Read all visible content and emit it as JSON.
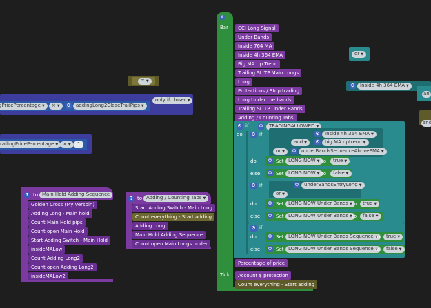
{
  "bar_block": {
    "bar_label": "Bar",
    "tick_label": "Tick",
    "items": [
      "CCI Long Signal",
      "Under Bands",
      "Inside 764 MA",
      "Inside 4h 364 EMA",
      "Big MA Up Trend",
      "Trailing SL TP Main Longs",
      "Long",
      "Protections / Stop trading",
      "Long Under the bands",
      "Trailing SL TP Under Bands",
      "Adding / Counting Tabs"
    ],
    "if_label": "if",
    "do_label": "do",
    "else_label": "else",
    "trading_allowed": "TRADINGALLOWED",
    "inside_4h": "Inside 4h 364 EMA",
    "and_op": "and",
    "big_ma": "big MA uptrend",
    "or_op": "or",
    "under_bands_seq": "underBandsSequenceAboveEMA",
    "set_label": "Set",
    "to_label": "to",
    "long_now": "LONG NOW",
    "true_val": "true",
    "false_val": "false",
    "under_bands_entry": "underBandsEntryLong",
    "long_now_under": "LONG NOW Under Bands",
    "long_now_under_seq": "LONG NOW Under Bands Sequence",
    "percentage_of_price": "Percentage of price",
    "account_protection": "Account $ protection",
    "count_everything": "Count everything - Start adding"
  },
  "left_blocks": {
    "price_percentage": "gPricePercentage",
    "times_op": "×",
    "adding_long": "addingLong2CloseTrailPips",
    "only_if_closer": "only if closer",
    "trailing_price": "railingPricePercentage",
    "times_op2": "×",
    "one_val": "1",
    "equals_op": "="
  },
  "func_main_hold": {
    "to_label": "to",
    "name": "Main Hold Adding Sequence",
    "items": [
      "Golden Cross (My Versoin)",
      "Adding Long - Main hold",
      "Count Main Hold pips",
      "Count open Main Hold",
      "Start Adding Switch - Main Hold",
      "insideMALow",
      "Count Adding Long2",
      "Count open Adding Long2",
      "insideMALow2"
    ]
  },
  "func_adding": {
    "to_label": "to",
    "name": "Adding / Counting Tabs",
    "items": [
      "Start Adding Switch - Main Long",
      "Count everything - Start adding",
      "Adding Long",
      "Main Hold Adding Sequence",
      "Count open Main Longs under"
    ]
  },
  "right_side": {
    "or_op": "or",
    "inside_4h": "Inside 4h 364 EMA",
    "and_frag": "an",
    "and_frag2": "and"
  }
}
